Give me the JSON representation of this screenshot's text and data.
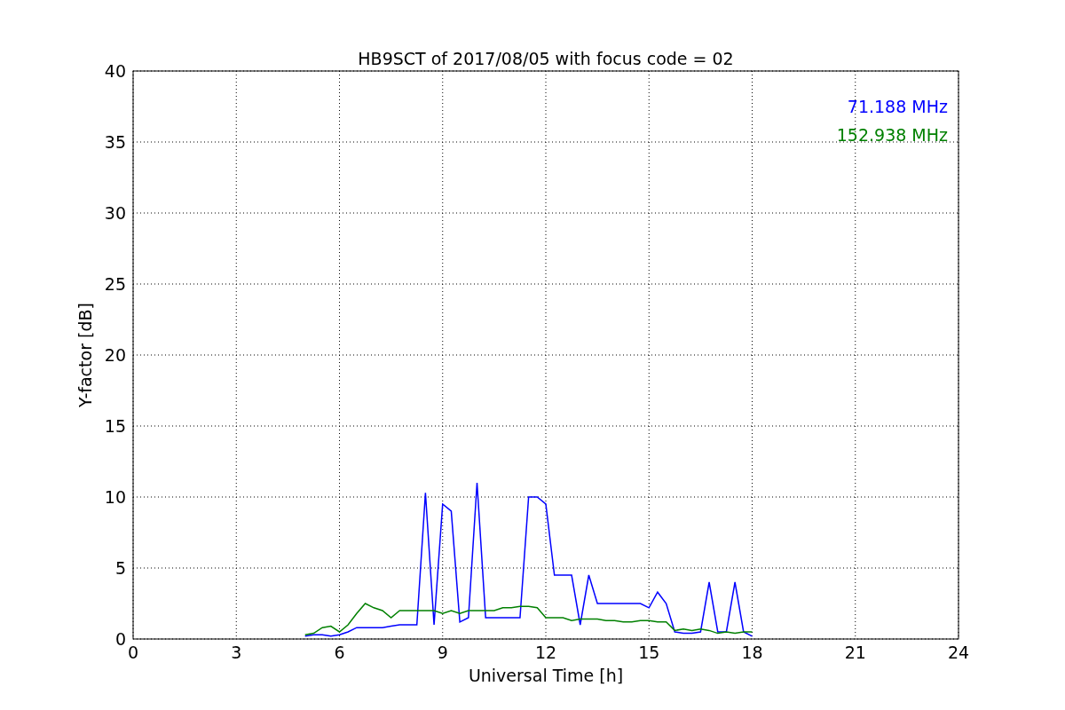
{
  "chart_data": {
    "type": "line",
    "title": "HB9SCT of 2017/08/05 with focus code = 02",
    "xlabel": "Universal Time [h]",
    "ylabel": "Y-factor [dB]",
    "x": [
      5.0,
      5.25,
      5.5,
      5.75,
      6.0,
      6.25,
      6.5,
      6.75,
      7.0,
      7.25,
      7.5,
      7.75,
      8.0,
      8.25,
      8.5,
      8.75,
      9.0,
      9.25,
      9.5,
      9.75,
      10.0,
      10.25,
      10.5,
      10.75,
      11.0,
      11.25,
      11.5,
      11.75,
      12.0,
      12.25,
      12.5,
      12.75,
      13.0,
      13.25,
      13.5,
      13.75,
      14.0,
      14.25,
      14.5,
      14.75,
      15.0,
      15.25,
      15.5,
      15.75,
      16.0,
      16.25,
      16.5,
      16.75,
      17.0,
      17.25,
      17.5,
      17.75,
      18.0
    ],
    "series": [
      {
        "name": "71.188 MHz",
        "color": "#0000ff",
        "values": [
          0.2,
          0.3,
          0.3,
          0.2,
          0.3,
          0.5,
          0.8,
          0.8,
          0.8,
          0.8,
          0.9,
          1.0,
          1.0,
          1.0,
          10.3,
          1.0,
          9.5,
          9.0,
          1.2,
          1.5,
          11.0,
          1.5,
          1.5,
          1.5,
          1.5,
          1.5,
          10.0,
          10.0,
          9.5,
          4.5,
          4.5,
          4.5,
          1.0,
          4.5,
          2.5,
          2.5,
          2.5,
          2.5,
          2.5,
          2.5,
          2.2,
          3.3,
          2.5,
          0.5,
          0.4,
          0.4,
          0.5,
          4.0,
          0.5,
          0.5,
          4.0,
          0.5,
          0.2
        ]
      },
      {
        "name": "152.938 MHz",
        "color": "#008000",
        "values": [
          0.3,
          0.4,
          0.8,
          0.9,
          0.5,
          1.0,
          1.8,
          2.5,
          2.2,
          2.0,
          1.5,
          2.0,
          2.0,
          2.0,
          2.0,
          2.0,
          1.8,
          2.0,
          1.8,
          2.0,
          2.0,
          2.0,
          2.0,
          2.2,
          2.2,
          2.3,
          2.3,
          2.2,
          1.5,
          1.5,
          1.5,
          1.3,
          1.4,
          1.4,
          1.4,
          1.3,
          1.3,
          1.2,
          1.2,
          1.3,
          1.3,
          1.2,
          1.2,
          0.6,
          0.7,
          0.6,
          0.7,
          0.6,
          0.4,
          0.5,
          0.4,
          0.5,
          0.5
        ]
      }
    ],
    "xlim": [
      0,
      24
    ],
    "ylim": [
      0,
      40
    ],
    "xticks": [
      0,
      3,
      6,
      9,
      12,
      15,
      18,
      21,
      24
    ],
    "yticks": [
      0,
      5,
      10,
      15,
      20,
      25,
      30,
      35,
      40
    ],
    "grid": true
  }
}
